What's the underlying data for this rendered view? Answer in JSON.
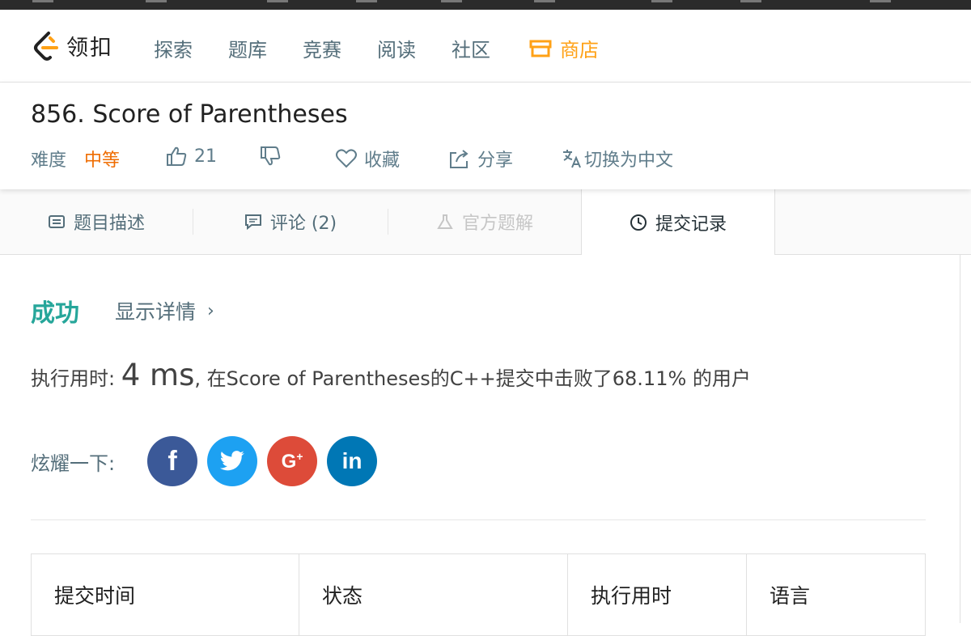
{
  "nav": {
    "logo_text": "领扣",
    "items": [
      "探索",
      "题库",
      "竞赛",
      "阅读",
      "社区"
    ],
    "store_label": "商店",
    "colors": {
      "store": "#ffa116",
      "logo_orange": "#ffa116"
    }
  },
  "problem": {
    "title": "856. Score of Parentheses",
    "difficulty_label": "难度",
    "difficulty_value": "中等",
    "likes": "21",
    "favorite_label": "收藏",
    "share_label": "分享",
    "translate_label": "切换为中文"
  },
  "tabs": [
    {
      "label": "题目描述",
      "icon": "description-icon",
      "state": "normal"
    },
    {
      "label": "评论 (2)",
      "icon": "comment-icon",
      "state": "normal"
    },
    {
      "label": "官方题解",
      "icon": "flask-icon",
      "state": "disabled"
    },
    {
      "label": "提交记录",
      "icon": "clock-icon",
      "state": "active"
    }
  ],
  "result": {
    "status": "成功",
    "details_label": "显示详情",
    "runtime_prefix": "执行用时: ",
    "runtime_value": "4 ms",
    "runtime_suffix": ", 在Score of Parentheses的C++提交中击败了68.11% 的用户",
    "share_label": "炫耀一下:",
    "social": [
      {
        "name": "facebook",
        "glyph": "f",
        "color": "#3b5998"
      },
      {
        "name": "twitter",
        "glyph": "twitter-bird-icon",
        "color": "#1da1f2"
      },
      {
        "name": "google-plus",
        "glyph": "G+",
        "color": "#dd4b39"
      },
      {
        "name": "linkedin",
        "glyph": "in",
        "color": "#0077b5"
      }
    ]
  },
  "table": {
    "headers": [
      "提交时间",
      "状态",
      "执行用时",
      "语言"
    ]
  }
}
